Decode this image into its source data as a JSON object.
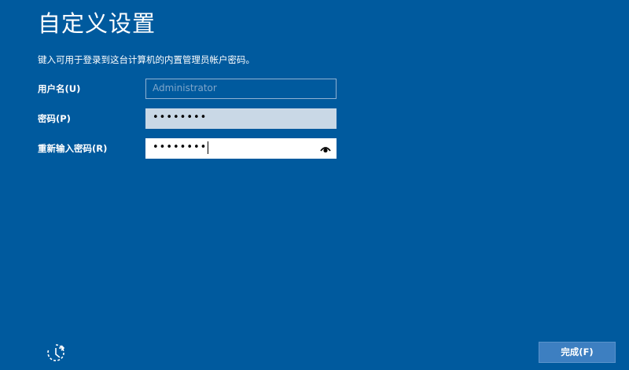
{
  "page": {
    "title": "自定义设置",
    "instruction": "键入可用于登录到这台计算机的内置管理员帐户密码。"
  },
  "form": {
    "username": {
      "label": "用户名(U)",
      "value": "Administrator"
    },
    "password": {
      "label": "密码(P)",
      "masked_value": "••••••••"
    },
    "reenter_password": {
      "label": "重新输入密码(R)",
      "masked_value": "••••••••",
      "reveal_icon": "eye-icon"
    }
  },
  "footer": {
    "accessibility_icon": "ease-of-access-icon",
    "finish_label": "完成(F)"
  },
  "colors": {
    "background": "#005a9e",
    "button": "#3d7fc1",
    "text": "#ffffff"
  }
}
